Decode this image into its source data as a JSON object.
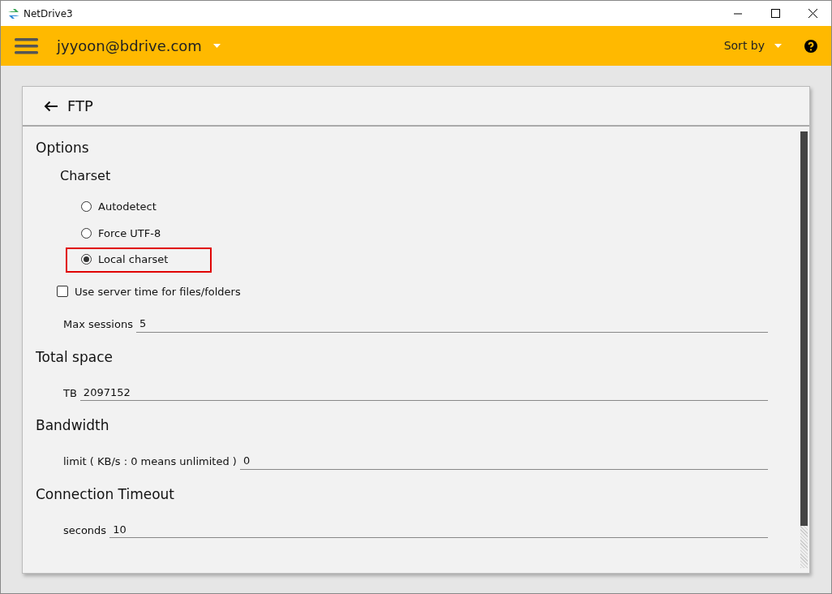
{
  "window": {
    "title": "NetDrive3"
  },
  "toolbar": {
    "account": "jyyoon@bdrive.com",
    "sort_label": "Sort by"
  },
  "page": {
    "title": "FTP"
  },
  "sections": [
    {
      "title": "Options",
      "items": [
        {
          "kind": "subheading",
          "label": "Charset"
        },
        {
          "kind": "radio",
          "label": "Autodetect",
          "selected": false,
          "highlighted": false
        },
        {
          "kind": "radio",
          "label": "Force UTF-8",
          "selected": false,
          "highlighted": false
        },
        {
          "kind": "radio",
          "label": "Local charset",
          "selected": true,
          "highlighted": true
        },
        {
          "kind": "checkbox",
          "label": "Use server time for files/folders",
          "checked": false
        },
        {
          "kind": "field",
          "label": "Max sessions",
          "value": "5"
        }
      ]
    },
    {
      "title": "Total space",
      "items": [
        {
          "kind": "field",
          "label": "TB",
          "value": "2097152"
        }
      ]
    },
    {
      "title": "Bandwidth",
      "items": [
        {
          "kind": "field",
          "label": "limit ( KB/s : 0 means unlimited )",
          "value": "0"
        }
      ]
    },
    {
      "title": "Connection Timeout",
      "items": [
        {
          "kind": "field",
          "label": "seconds",
          "value": "10"
        }
      ]
    }
  ]
}
